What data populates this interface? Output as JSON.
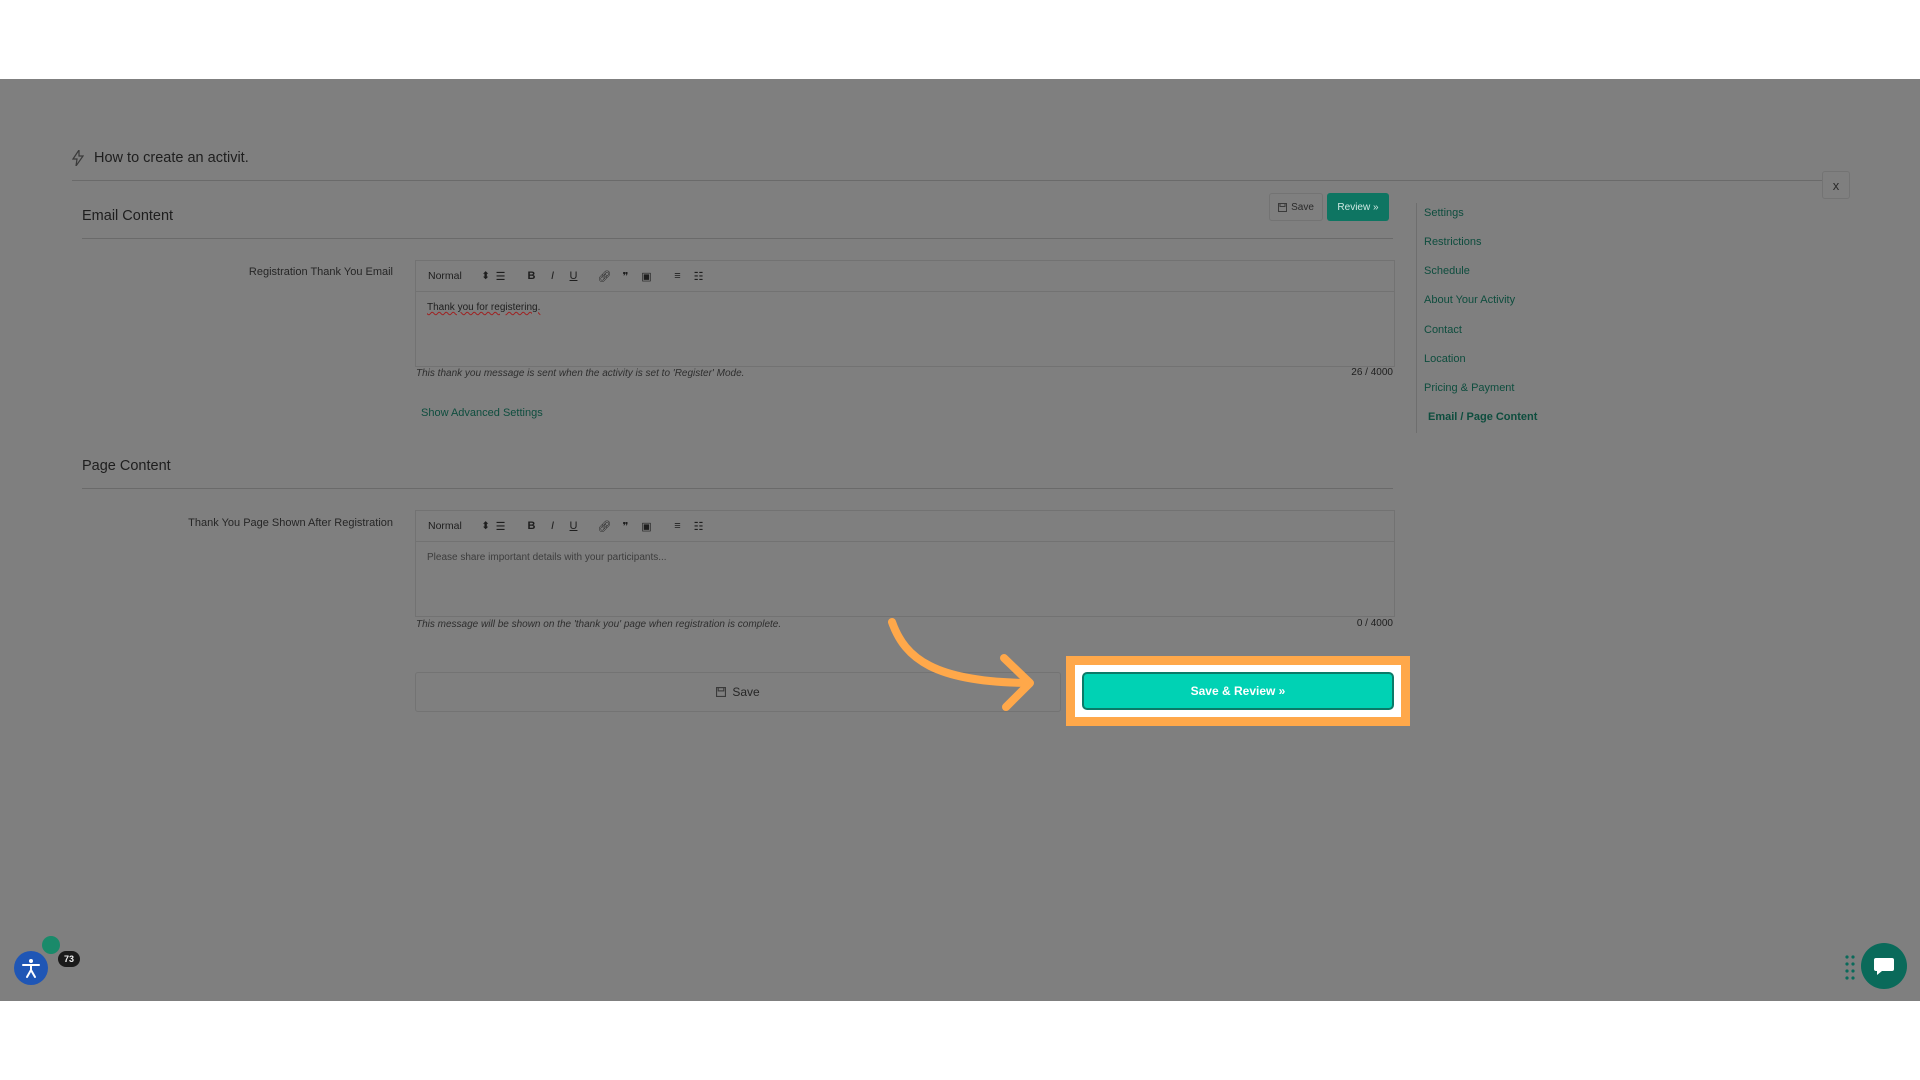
{
  "page": {
    "title": "How to create an activit.",
    "close_label": "x"
  },
  "header_actions": {
    "save_label": "Save",
    "review_label": "Review »"
  },
  "email_section": {
    "title": "Email Content",
    "field_label": "Registration Thank You Email",
    "format_select": "Normal",
    "content": "Thank you for registering.",
    "help_text": "This thank you message is sent when the activity is set to 'Register' Mode.",
    "char_count": "26 / 4000",
    "advanced_link": "Show Advanced Settings"
  },
  "page_section": {
    "title": "Page Content",
    "field_label": "Thank You Page Shown After Registration",
    "format_select": "Normal",
    "placeholder": "Please share important details with your participants...",
    "help_text": "This message will be shown on the 'thank you' page when registration is complete.",
    "char_count": "0 / 4000"
  },
  "footer_actions": {
    "save_label": "Save",
    "save_review_label": "Save & Review »"
  },
  "sidebar": {
    "items": [
      {
        "label": "Settings"
      },
      {
        "label": "Restrictions"
      },
      {
        "label": "Schedule"
      },
      {
        "label": "About Your Activity"
      },
      {
        "label": "Contact"
      },
      {
        "label": "Location"
      },
      {
        "label": "Pricing & Payment"
      },
      {
        "label": "Email / Page Content",
        "active": true
      }
    ]
  },
  "widgets": {
    "notification_count": "73"
  },
  "colors": {
    "overlay": "#7f7f7f",
    "accent_green": "#0e7562",
    "cta_teal": "#00d2b4",
    "highlight_orange": "#ffa84a",
    "accessibility_blue": "#1f56b5"
  },
  "icons": [
    "bolt-icon",
    "close-icon",
    "save-icon",
    "align-icon",
    "bold-icon",
    "italic-icon",
    "underline-icon",
    "link-icon",
    "quote-icon",
    "image-icon",
    "ordered-list-icon",
    "bullet-list-icon",
    "accessibility-icon",
    "chat-icon",
    "grip-icon",
    "arrow-annotation"
  ]
}
